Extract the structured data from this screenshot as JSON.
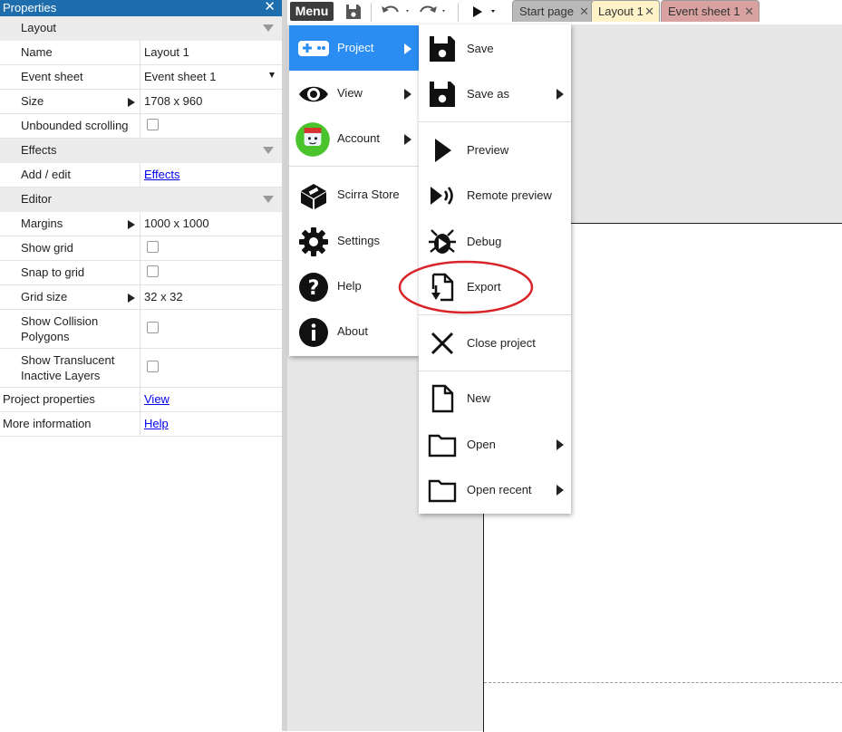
{
  "properties": {
    "title": "Properties",
    "close_glyph": "✕",
    "sections": {
      "layout": "Layout",
      "effects": "Effects",
      "editor": "Editor"
    },
    "rows": {
      "name": {
        "label": "Name",
        "value": "Layout 1"
      },
      "event_sheet": {
        "label": "Event sheet",
        "value": "Event sheet 1"
      },
      "size": {
        "label": "Size",
        "value": "1708 x 960"
      },
      "unbounded": {
        "label": "Unbounded scrolling",
        "checked": false
      },
      "add_edit": {
        "label": "Add / edit",
        "value": "Effects"
      },
      "margins": {
        "label": "Margins",
        "value": "1000 x 1000"
      },
      "show_grid": {
        "label": "Show grid",
        "checked": false
      },
      "snap_grid": {
        "label": "Snap to grid",
        "checked": false
      },
      "grid_size": {
        "label": "Grid size",
        "value": "32 x 32"
      },
      "collision": {
        "label_line1": "Show Collision",
        "label_line2": "Polygons",
        "checked": false
      },
      "translucent": {
        "label_line1": "Show Translucent",
        "label_line2": "Inactive Layers",
        "checked": false
      },
      "project_props": {
        "label": "Project properties",
        "value": "View"
      },
      "more_info": {
        "label": "More information",
        "value": "Help"
      }
    }
  },
  "toolbar": {
    "menu_label": "Menu",
    "tabs": [
      {
        "label": "Start page",
        "color": "#b9b9b9"
      },
      {
        "label": "Layout 1",
        "color": "#fdf2c8"
      },
      {
        "label": "Event sheet 1",
        "color": "#d7a2a0"
      }
    ],
    "tab_close_glyph": "✕",
    "icons": [
      "save-icon",
      "undo-icon",
      "redo-icon",
      "play-icon"
    ]
  },
  "main_menu": {
    "items": [
      {
        "label": "Project",
        "icon": "gamepad-icon",
        "has_submenu": true,
        "active": true
      },
      {
        "label": "View",
        "icon": "eye-icon",
        "has_submenu": true
      },
      {
        "label": "Account",
        "icon": "avatar-icon",
        "has_submenu": true
      },
      {
        "label": "Scirra Store",
        "icon": "store-icon"
      },
      {
        "label": "Settings",
        "icon": "gear-icon"
      },
      {
        "label": "Help",
        "icon": "help-icon"
      },
      {
        "label": "About",
        "icon": "info-icon"
      }
    ],
    "accent_color": "#2b8cf2"
  },
  "project_menu": {
    "items": [
      {
        "label": "Save",
        "icon": "save-icon"
      },
      {
        "label": "Save as",
        "icon": "save-as-icon",
        "has_submenu": true
      },
      {
        "label": "Preview",
        "icon": "play-icon"
      },
      {
        "label": "Remote preview",
        "icon": "remote-preview-icon"
      },
      {
        "label": "Debug",
        "icon": "bug-icon"
      },
      {
        "label": "Export",
        "icon": "export-icon",
        "highlighted": true
      },
      {
        "label": "Close project",
        "icon": "close-icon"
      },
      {
        "label": "New",
        "icon": "new-file-icon"
      },
      {
        "label": "Open",
        "icon": "folder-icon",
        "has_submenu": true
      },
      {
        "label": "Open recent",
        "icon": "folder-icon",
        "has_submenu": true
      }
    ],
    "annotation_color": "#d9252a"
  }
}
